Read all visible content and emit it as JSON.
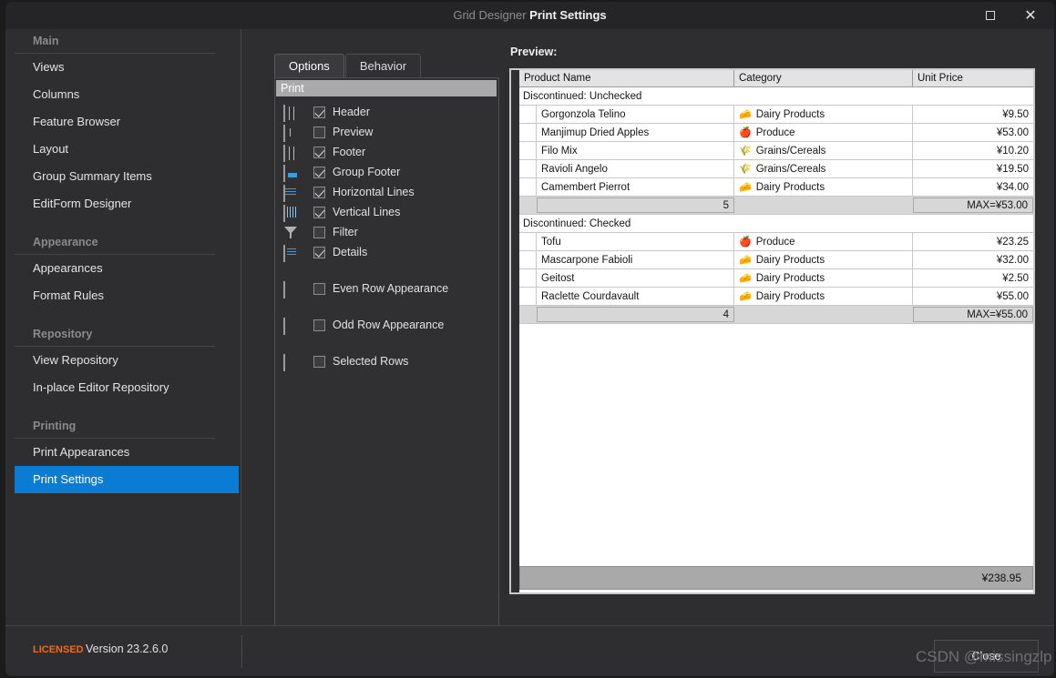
{
  "window": {
    "app_name": "Grid Designer",
    "page_title": "Print Settings",
    "maximize_label": "□",
    "close_label": "✕"
  },
  "sidebar": {
    "groups": [
      {
        "title": "Main",
        "items": [
          {
            "label": "Views",
            "active": false
          },
          {
            "label": "Columns",
            "active": false
          },
          {
            "label": "Feature Browser",
            "active": false
          },
          {
            "label": "Layout",
            "active": false
          },
          {
            "label": "Group Summary Items",
            "active": false
          },
          {
            "label": "EditForm Designer",
            "active": false
          }
        ]
      },
      {
        "title": "Appearance",
        "items": [
          {
            "label": "Appearances",
            "active": false
          },
          {
            "label": "Format Rules",
            "active": false
          }
        ]
      },
      {
        "title": "Repository",
        "items": [
          {
            "label": "View Repository",
            "active": false
          },
          {
            "label": "In-place Editor Repository",
            "active": false
          }
        ]
      },
      {
        "title": "Printing",
        "items": [
          {
            "label": "Print Appearances",
            "active": false
          },
          {
            "label": "Print Settings",
            "active": true
          }
        ]
      }
    ]
  },
  "options_panel": {
    "tabs": [
      {
        "label": "Options",
        "selected": true
      },
      {
        "label": "Behavior",
        "selected": false
      }
    ],
    "category": "Print",
    "items": [
      {
        "label": "Header",
        "checked": true,
        "icon": "grid-header-icon",
        "gap": false
      },
      {
        "label": "Preview",
        "checked": false,
        "icon": "grid-preview-icon",
        "gap": false
      },
      {
        "label": "Footer",
        "checked": true,
        "icon": "grid-footer-icon",
        "gap": false
      },
      {
        "label": "Group Footer",
        "checked": true,
        "icon": "grid-groupfooter-icon",
        "gap": false
      },
      {
        "label": "Horizontal Lines",
        "checked": true,
        "icon": "grid-hlines-icon",
        "gap": false
      },
      {
        "label": "Vertical Lines",
        "checked": true,
        "icon": "grid-vlines-icon",
        "gap": false
      },
      {
        "label": "Filter",
        "checked": false,
        "icon": "filter-icon",
        "gap": false
      },
      {
        "label": "Details",
        "checked": true,
        "icon": "grid-details-icon",
        "gap": false
      },
      {
        "label": "Even Row Appearance",
        "checked": false,
        "icon": "grid-evenrow-icon",
        "gap": true
      },
      {
        "label": "Odd Row Appearance",
        "checked": false,
        "icon": "grid-oddrow-icon",
        "gap": true
      },
      {
        "label": "Selected Rows",
        "checked": false,
        "icon": "grid-selectedrows-icon",
        "gap": true
      }
    ]
  },
  "preview": {
    "label": "Preview:",
    "columns": [
      "Product Name",
      "Category",
      "Unit Price"
    ],
    "groups": [
      {
        "header": "Discontinued: Unchecked",
        "rows": [
          {
            "name": "Gorgonzola Telino",
            "category": "Dairy Products",
            "icon": "cheese",
            "price": "¥9.50"
          },
          {
            "name": "Manjimup Dried Apples",
            "category": "Produce",
            "icon": "apple",
            "price": "¥53.00"
          },
          {
            "name": "Filo Mix",
            "category": "Grains/Cereals",
            "icon": "grain",
            "price": "¥10.20"
          },
          {
            "name": "Ravioli Angelo",
            "category": "Grains/Cereals",
            "icon": "grain",
            "price": "¥19.50"
          },
          {
            "name": "Camembert Pierrot",
            "category": "Dairy Products",
            "icon": "cheese",
            "price": "¥34.00"
          }
        ],
        "summary_count": "5",
        "summary_max": "MAX=¥53.00"
      },
      {
        "header": "Discontinued: Checked",
        "rows": [
          {
            "name": "Tofu",
            "category": "Produce",
            "icon": "apple",
            "price": "¥23.25"
          },
          {
            "name": "Mascarpone Fabioli",
            "category": "Dairy Products",
            "icon": "cheese",
            "price": "¥32.00"
          },
          {
            "name": "Geitost",
            "category": "Dairy Products",
            "icon": "cheese",
            "price": "¥2.50"
          },
          {
            "name": "Raclette Courdavault",
            "category": "Dairy Products",
            "icon": "cheese",
            "price": "¥55.00"
          }
        ],
        "summary_count": "4",
        "summary_max": "MAX=¥55.00"
      }
    ],
    "grand_total": "¥238.95"
  },
  "footer": {
    "license": "LICENSED",
    "version": "Version 23.2.6.0",
    "close_label": "Close"
  },
  "watermark": "CSDN @missingzlp",
  "colors": {
    "accent": "#0a7cd4",
    "license_orange": "#ef6a16",
    "panel_bg": "#2e2e31",
    "titlebar_bg": "#252527",
    "category_bar": "#a9a9a9"
  }
}
